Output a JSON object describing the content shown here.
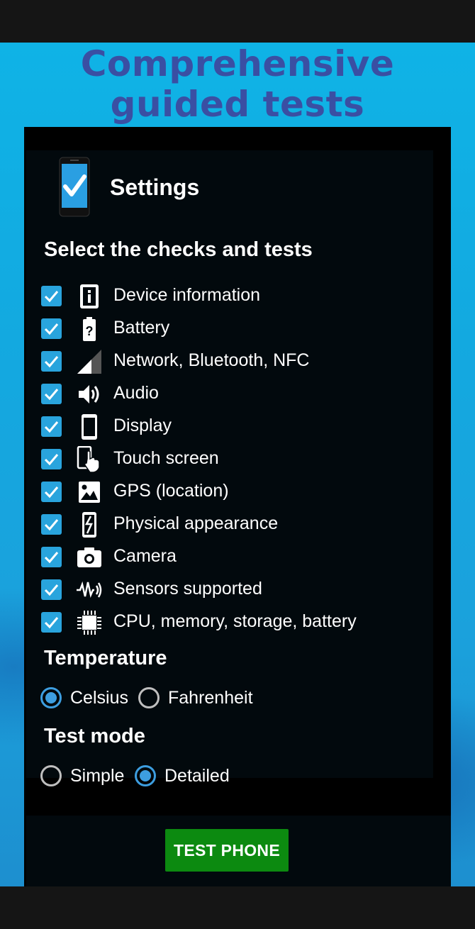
{
  "headline": {
    "line1": "Comprehensive",
    "line2": "guided tests"
  },
  "settings": {
    "title": "Settings",
    "checks_heading": "Select the checks and tests",
    "checks": [
      {
        "label": "Device information",
        "icon": "info-icon",
        "checked": true
      },
      {
        "label": "Battery",
        "icon": "battery-icon",
        "checked": true
      },
      {
        "label": "Network, Bluetooth, NFC",
        "icon": "signal-icon",
        "checked": true
      },
      {
        "label": "Audio",
        "icon": "speaker-icon",
        "checked": true
      },
      {
        "label": "Display",
        "icon": "phone-display-icon",
        "checked": true
      },
      {
        "label": "Touch screen",
        "icon": "touch-icon",
        "checked": true
      },
      {
        "label": "GPS (location)",
        "icon": "image-icon",
        "checked": true
      },
      {
        "label": "Physical appearance",
        "icon": "broken-phone-icon",
        "checked": true
      },
      {
        "label": "Camera",
        "icon": "camera-icon",
        "checked": true
      },
      {
        "label": "Sensors supported",
        "icon": "sensor-wave-icon",
        "checked": true
      },
      {
        "label": "CPU, memory, storage, battery",
        "icon": "chip-icon",
        "checked": true
      }
    ],
    "temperature": {
      "heading": "Temperature",
      "options": [
        "Celsius",
        "Fahrenheit"
      ],
      "selected": "Celsius"
    },
    "test_mode": {
      "heading": "Test mode",
      "options": [
        "Simple",
        "Detailed"
      ],
      "selected": "Detailed"
    }
  },
  "button": {
    "label": "TEST PHONE"
  },
  "colors": {
    "accent": "#29a4dd",
    "button": "#0c8a10",
    "headline": "#3a4fa3",
    "panel": "#02090d"
  }
}
